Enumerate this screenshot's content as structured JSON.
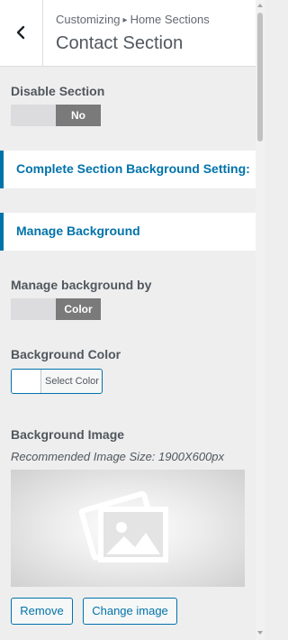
{
  "header": {
    "breadcrumb_root": "Customizing",
    "breadcrumb_separator": "▸",
    "breadcrumb_section": "Home Sections",
    "title": "Contact Section",
    "back_icon": "chevron-left-icon"
  },
  "disable_section": {
    "label": "Disable Section",
    "value": "No"
  },
  "complete_bg_panel": {
    "label": "Complete Section Background Setting:"
  },
  "manage_bg_panel": {
    "label": "Manage Background"
  },
  "manage_by": {
    "label": "Manage background by",
    "value": "Color"
  },
  "bg_color": {
    "label": "Background Color",
    "button_label": "Select Color",
    "swatch_color": "#ffffff"
  },
  "bg_image": {
    "label": "Background Image",
    "hint": "Recommended Image Size: 1900X600px",
    "placeholder_icon": "image-icon",
    "remove_label": "Remove",
    "change_label": "Change image"
  },
  "colors": {
    "accent": "#0073aa",
    "toggle_on": "#7a7a7a",
    "toggle_off": "#dcdcde"
  }
}
